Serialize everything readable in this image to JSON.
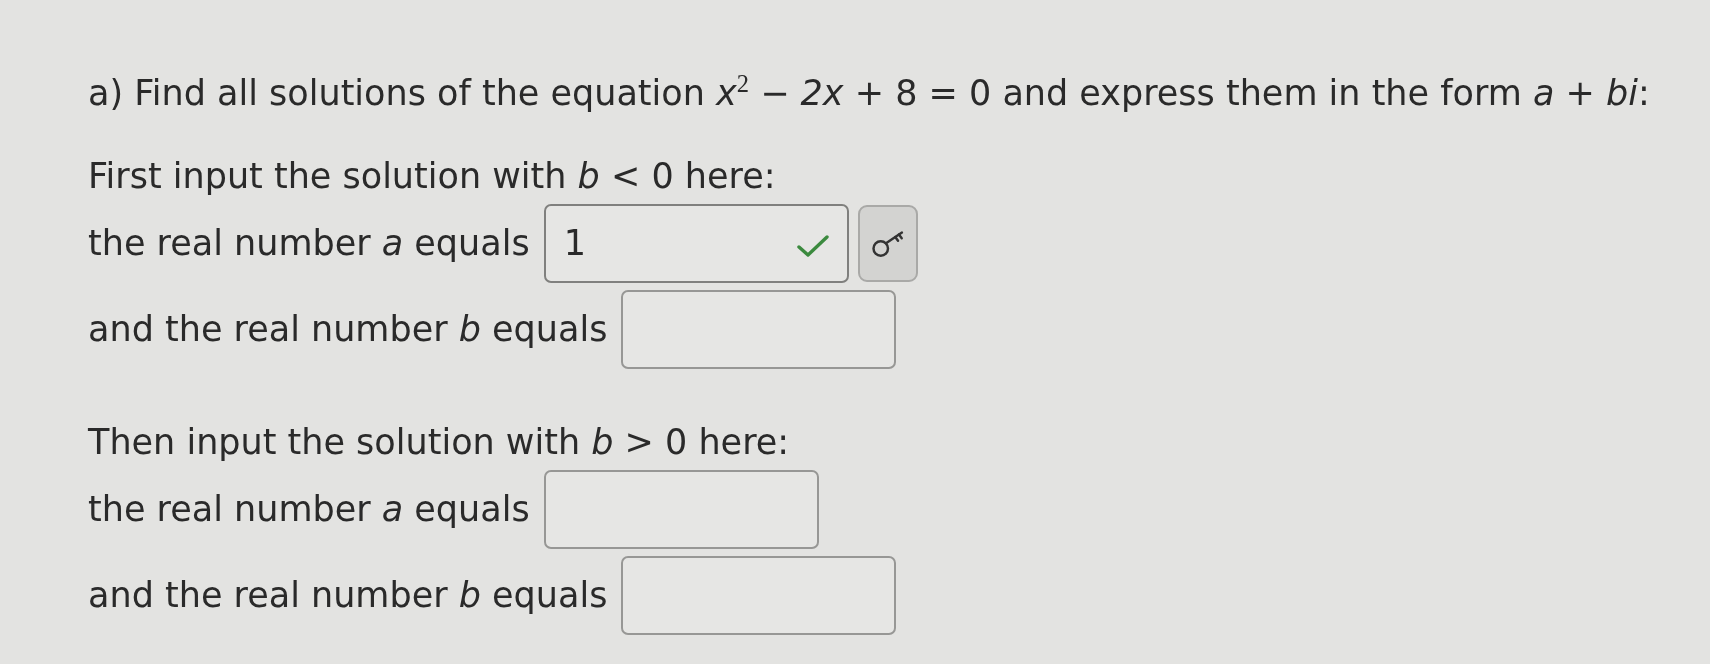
{
  "question": {
    "text": "a) Find all solutions of the equation *x*$^{2}$ − *2x* + 8 = 0 and express them in the form *a* + *bi*:"
  },
  "parts": [
    {
      "prompt": "First input the solution with *b* < 0 here:",
      "fields": [
        {
          "label": "the real number *a* equals",
          "value": "1",
          "correct": true,
          "key_button": true
        },
        {
          "label": "and the real number *b* equals",
          "correct": false,
          "key_button": false
        }
      ]
    },
    {
      "prompt": "Then input the solution with *b* > 0 here:",
      "fields": [
        {
          "label": "the real number *a* equals",
          "correct": false,
          "key_button": false
        },
        {
          "label": "and the real number *b* equals",
          "correct": false,
          "key_button": false
        }
      ]
    }
  ]
}
